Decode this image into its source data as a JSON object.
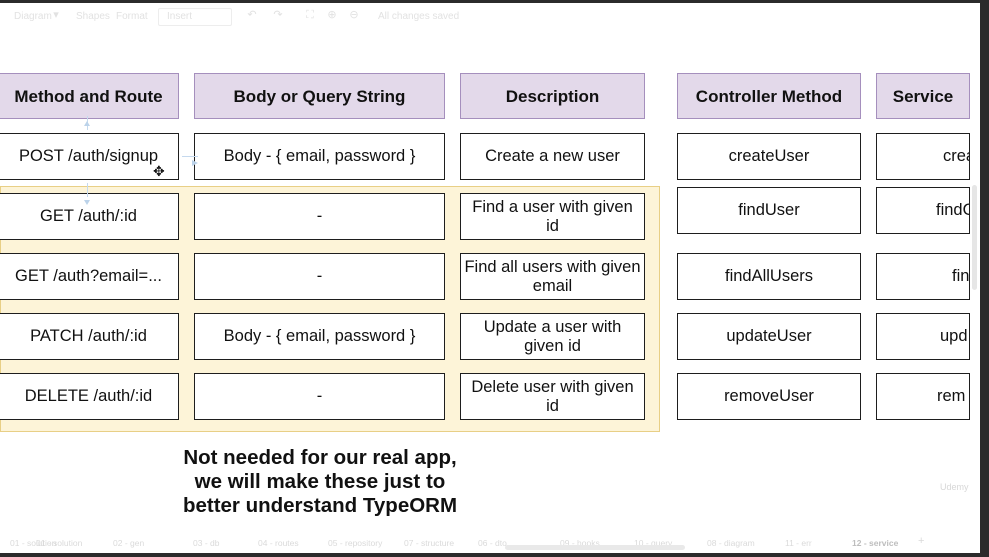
{
  "toolbar": {
    "diagram_menu": "Diagram",
    "shapes_tab": "Shapes",
    "format_tab": "Format",
    "insert_menu": "Insert",
    "status": "All changes saved"
  },
  "table": {
    "headers": [
      "Method and Route",
      "Body or Query String",
      "Description",
      "Controller Method",
      "Service"
    ],
    "rows": [
      {
        "route": "POST /auth/signup",
        "body": "Body - { email, password }",
        "description": "Create a new user",
        "controller": "createUser",
        "service": "crea"
      },
      {
        "route": "GET /auth/:id",
        "body": "-",
        "description": "Find a user with given id",
        "controller": "findUser",
        "service": "findO"
      },
      {
        "route": "GET /auth?email=...",
        "body": "-",
        "description": "Find all users with given email",
        "controller": "findAllUsers",
        "service": "fin"
      },
      {
        "route": "PATCH /auth/:id",
        "body": "Body - { email, password }",
        "description": "Update a user with given id",
        "controller": "updateUser",
        "service": "upd"
      },
      {
        "route": "DELETE /auth/:id",
        "body": "-",
        "description": "Delete user with given id",
        "controller": "removeUser",
        "service": "rem"
      }
    ]
  },
  "note": {
    "line1": "Not needed for our real app,",
    "line2": "we will make these just to",
    "line3": "better understand TypeORM"
  },
  "watermark": "Udemy",
  "page_tabs": [
    "01 - solution",
    "02 - gen",
    "03 - db",
    "04 - routes",
    "05 - repository",
    "06 - dto",
    "07 - structure",
    "08 - diagram",
    "09 - hooks",
    "10 - query",
    "11 - err",
    "12 - service"
  ],
  "active_page_tab_index": 11,
  "colors": {
    "header_fill": "#e3d9ea",
    "header_border": "#a58fbd",
    "highlight_fill": "#fdf4d8",
    "highlight_border": "#e8cf86",
    "cell_border": "#1e1e1e"
  }
}
